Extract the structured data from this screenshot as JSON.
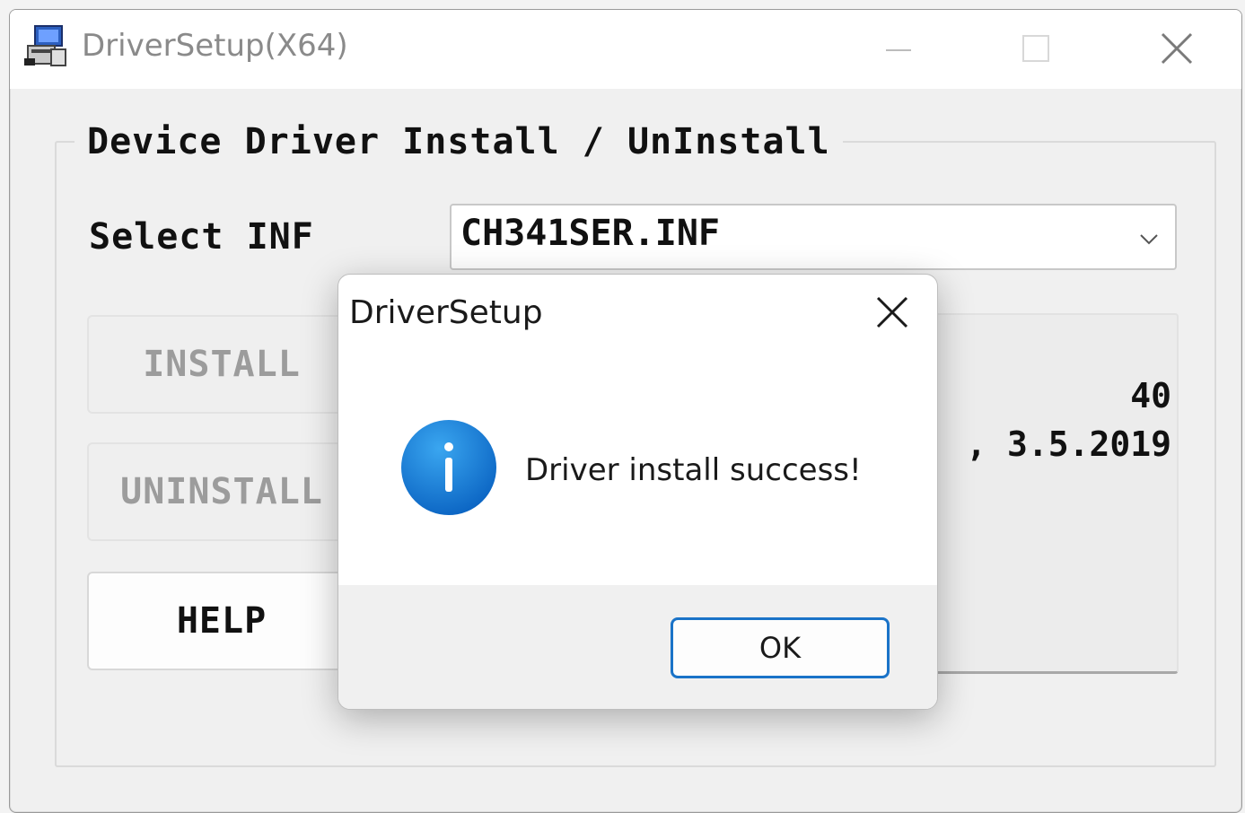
{
  "window": {
    "title": "DriverSetup(X64)",
    "app_icon": "computer-install-icon",
    "controls": [
      "minimize-icon",
      "maximize-icon",
      "close-icon"
    ]
  },
  "main": {
    "group_title": "Device Driver Install / UnInstall",
    "select_label": "Select INF",
    "inf_value": "CH341SER.INF",
    "buttons": {
      "install": "INSTALL",
      "uninstall": "UNINSTALL",
      "help": "HELP"
    },
    "info": {
      "line1": "40",
      "line2": ", 3.5.2019"
    }
  },
  "dialog": {
    "title": "DriverSetup",
    "message": "Driver install success!",
    "ok_label": "OK",
    "icon": "info-icon",
    "accent_color": "#1a73c8"
  }
}
